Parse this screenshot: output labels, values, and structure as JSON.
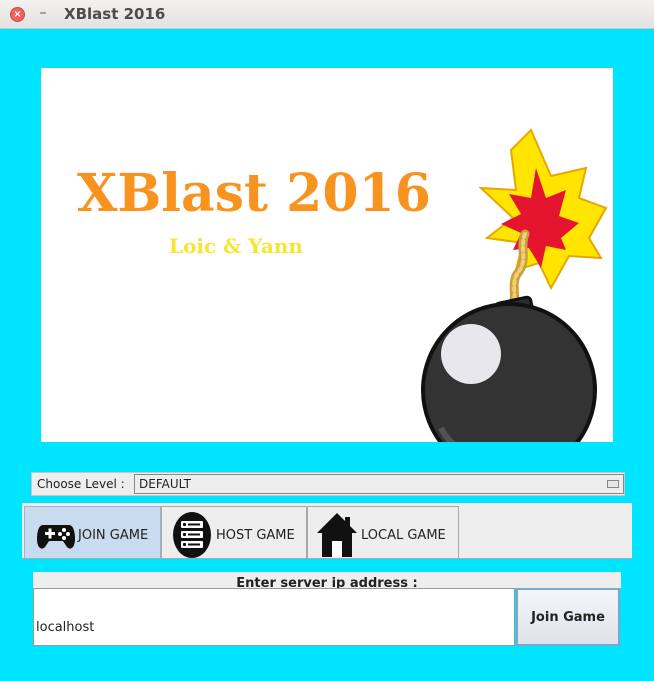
{
  "window": {
    "title": "XBlast 2016",
    "close_glyph": "×",
    "minimize_glyph": "–"
  },
  "banner": {
    "title": "XBlast 2016",
    "subtitle": "Loic & Yann",
    "title_color": "#f7931e",
    "subtitle_color": "#f5e62e",
    "image_icon": "bomb-icon"
  },
  "level": {
    "label": "Choose Level :",
    "selected": "DEFAULT"
  },
  "tabs": [
    {
      "label": "JOIN GAME",
      "icon": "gamepad-icon",
      "active": true
    },
    {
      "label": "HOST GAME",
      "icon": "server-icon",
      "active": false
    },
    {
      "label": "LOCAL GAME",
      "icon": "house-icon",
      "active": false
    }
  ],
  "join": {
    "prompt": "Enter server ip address :",
    "ip_value": "localhost",
    "button_label": "Join Game"
  },
  "colors": {
    "background": "#00e5ff",
    "tab_active": "#c8dbef",
    "panel_gray": "#eeeeee"
  }
}
